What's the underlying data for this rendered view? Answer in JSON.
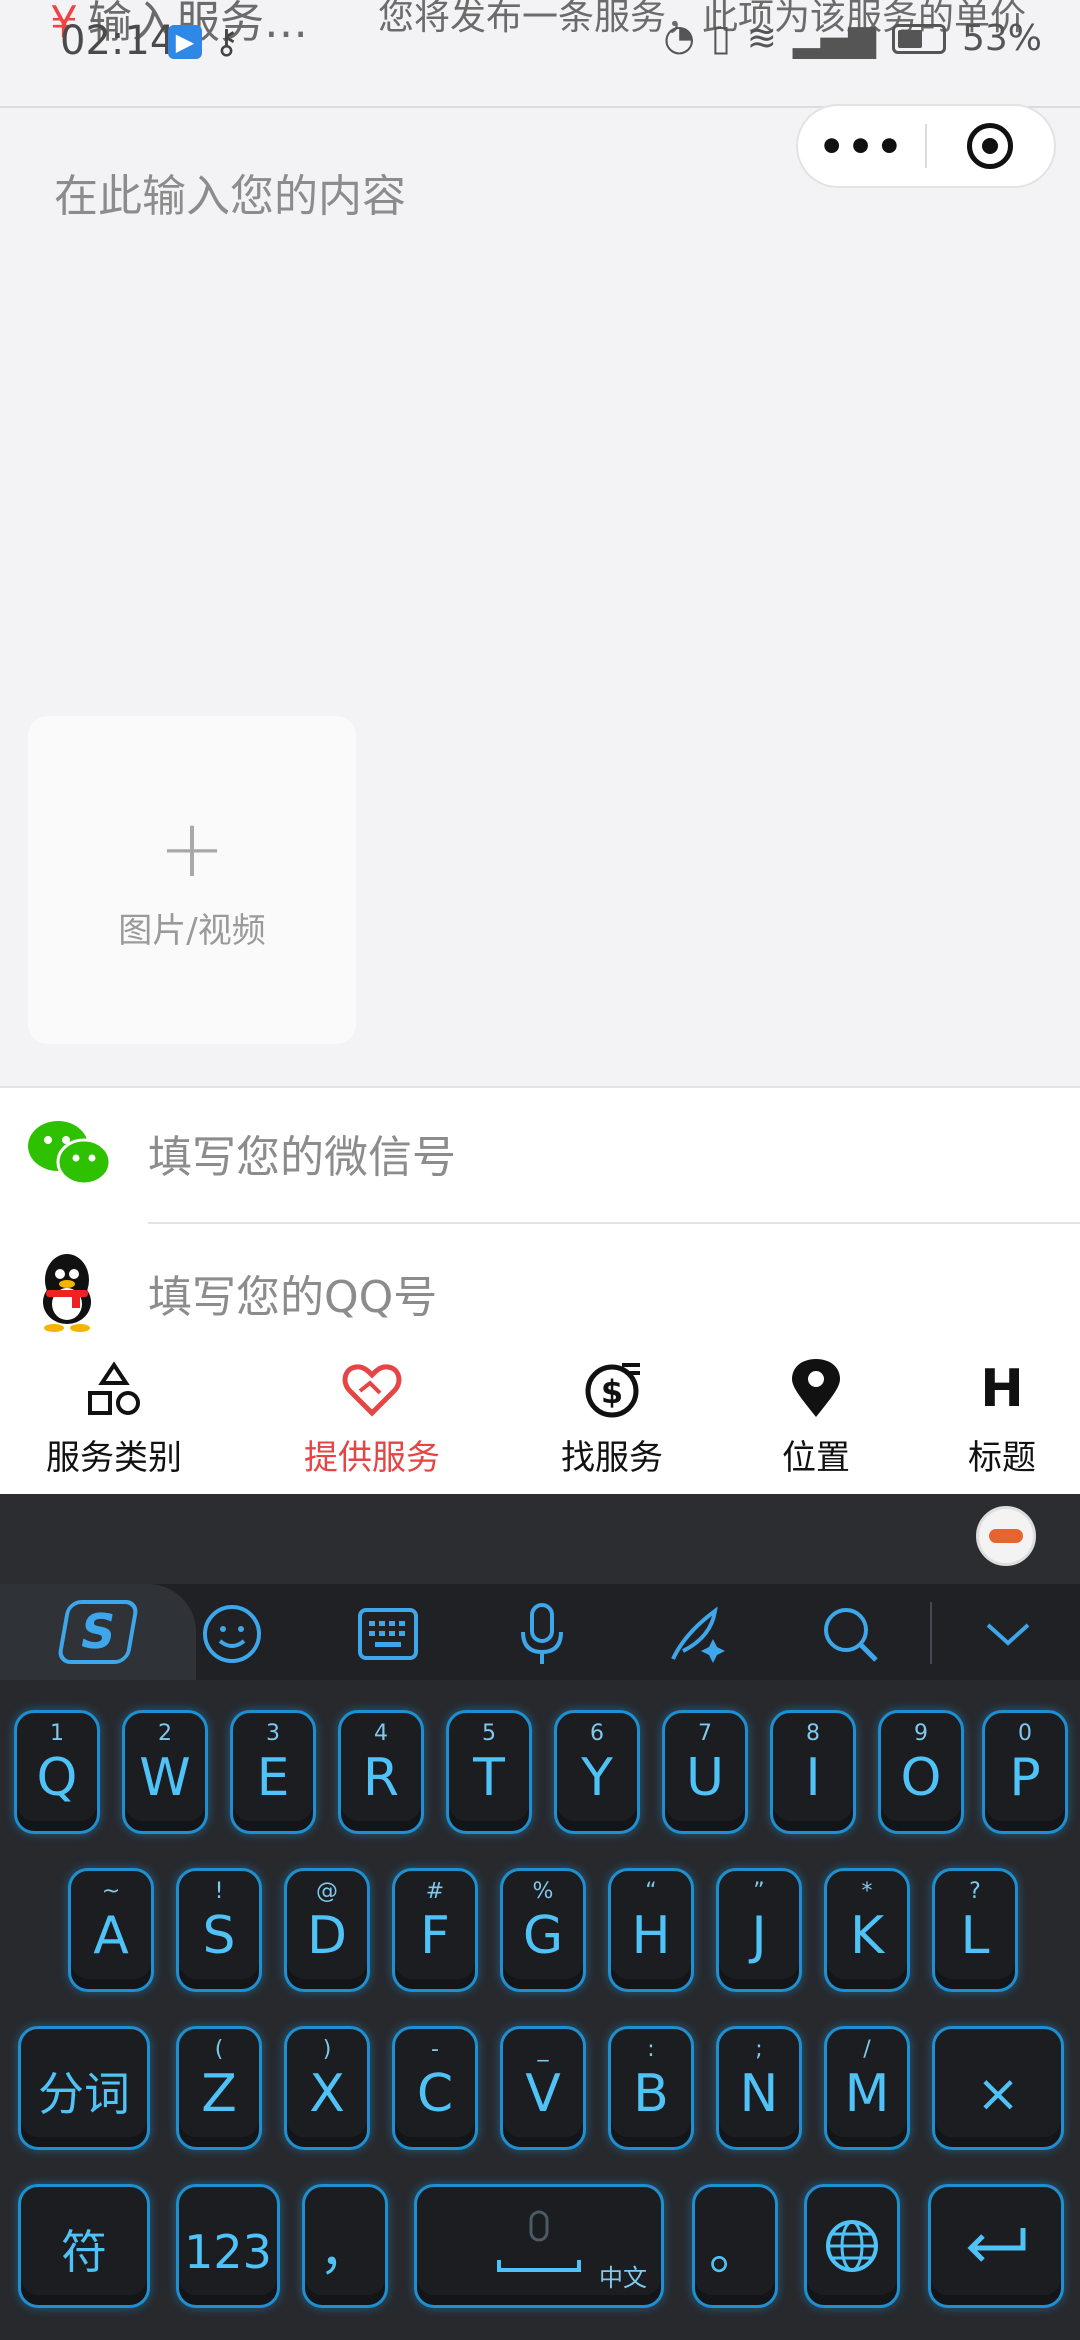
{
  "status": {
    "time": "02:14",
    "battery": "53%"
  },
  "header": {
    "price_placeholder": "输入服务…",
    "notice": "您将发布一条服务，此项为该服务的单价"
  },
  "content": {
    "placeholder": "在此输入您的内容",
    "upload_label": "图片/视频"
  },
  "contact": {
    "wechat_placeholder": "填写您的微信号",
    "qq_placeholder": "填写您的QQ号"
  },
  "tabs": [
    {
      "label": "服务类别",
      "icon": "shapes-icon"
    },
    {
      "label": "提供服务",
      "icon": "heart-handshake-icon",
      "active": true
    },
    {
      "label": "找服务",
      "icon": "dollar-coin-icon"
    },
    {
      "label": "位置",
      "icon": "location-pin-icon"
    },
    {
      "label": "标题",
      "icon": "heading-icon",
      "glyph": "H"
    }
  ],
  "colors": {
    "active_tab": "#e64545",
    "key_glow": "#4fc3f7"
  },
  "keyboard": {
    "row1": [
      {
        "k": "Q",
        "s": "1"
      },
      {
        "k": "W",
        "s": "2"
      },
      {
        "k": "E",
        "s": "3"
      },
      {
        "k": "R",
        "s": "4"
      },
      {
        "k": "T",
        "s": "5"
      },
      {
        "k": "Y",
        "s": "6"
      },
      {
        "k": "U",
        "s": "7"
      },
      {
        "k": "I",
        "s": "8"
      },
      {
        "k": "O",
        "s": "9"
      },
      {
        "k": "P",
        "s": "0"
      }
    ],
    "row2": [
      {
        "k": "A",
        "s": "~"
      },
      {
        "k": "S",
        "s": "!"
      },
      {
        "k": "D",
        "s": "@"
      },
      {
        "k": "F",
        "s": "#"
      },
      {
        "k": "G",
        "s": "%"
      },
      {
        "k": "H",
        "s": "“"
      },
      {
        "k": "J",
        "s": "”"
      },
      {
        "k": "K",
        "s": "*"
      },
      {
        "k": "L",
        "s": "?"
      }
    ],
    "row3": [
      {
        "k": "Z",
        "s": "("
      },
      {
        "k": "X",
        "s": ")"
      },
      {
        "k": "C",
        "s": "-"
      },
      {
        "k": "V",
        "s": "_"
      },
      {
        "k": "B",
        "s": ":"
      },
      {
        "k": "N",
        "s": ";"
      },
      {
        "k": "M",
        "s": "/"
      }
    ],
    "fenci": "分词",
    "delete": "×",
    "fu": "符",
    "num": "123",
    "comma": "，",
    "space_tag": "中文",
    "period": "。"
  }
}
